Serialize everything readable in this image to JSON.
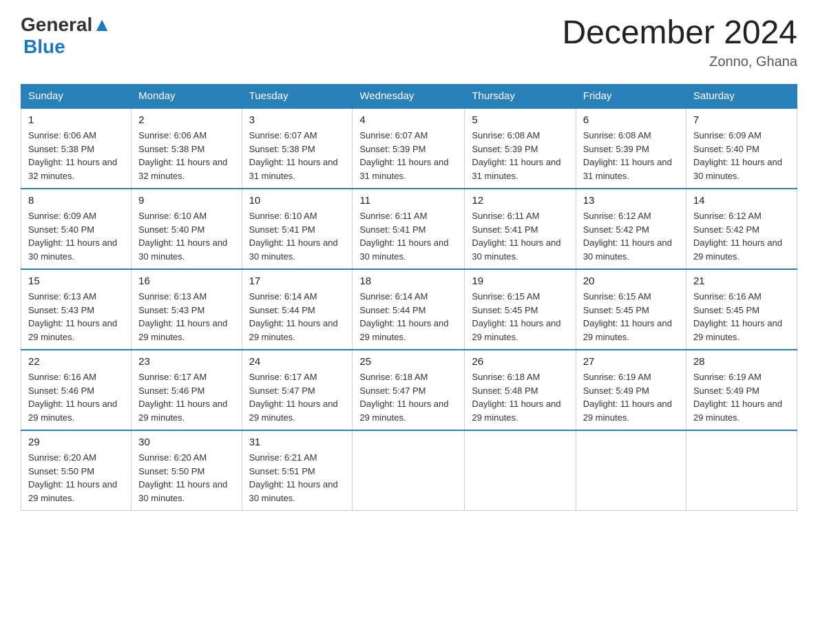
{
  "header": {
    "logo_general": "General",
    "logo_blue": "Blue",
    "month_year": "December 2024",
    "location": "Zonno, Ghana"
  },
  "days_of_week": [
    "Sunday",
    "Monday",
    "Tuesday",
    "Wednesday",
    "Thursday",
    "Friday",
    "Saturday"
  ],
  "weeks": [
    [
      {
        "day": "1",
        "sunrise": "6:06 AM",
        "sunset": "5:38 PM",
        "daylight": "11 hours and 32 minutes."
      },
      {
        "day": "2",
        "sunrise": "6:06 AM",
        "sunset": "5:38 PM",
        "daylight": "11 hours and 32 minutes."
      },
      {
        "day": "3",
        "sunrise": "6:07 AM",
        "sunset": "5:38 PM",
        "daylight": "11 hours and 31 minutes."
      },
      {
        "day": "4",
        "sunrise": "6:07 AM",
        "sunset": "5:39 PM",
        "daylight": "11 hours and 31 minutes."
      },
      {
        "day": "5",
        "sunrise": "6:08 AM",
        "sunset": "5:39 PM",
        "daylight": "11 hours and 31 minutes."
      },
      {
        "day": "6",
        "sunrise": "6:08 AM",
        "sunset": "5:39 PM",
        "daylight": "11 hours and 31 minutes."
      },
      {
        "day": "7",
        "sunrise": "6:09 AM",
        "sunset": "5:40 PM",
        "daylight": "11 hours and 30 minutes."
      }
    ],
    [
      {
        "day": "8",
        "sunrise": "6:09 AM",
        "sunset": "5:40 PM",
        "daylight": "11 hours and 30 minutes."
      },
      {
        "day": "9",
        "sunrise": "6:10 AM",
        "sunset": "5:40 PM",
        "daylight": "11 hours and 30 minutes."
      },
      {
        "day": "10",
        "sunrise": "6:10 AM",
        "sunset": "5:41 PM",
        "daylight": "11 hours and 30 minutes."
      },
      {
        "day": "11",
        "sunrise": "6:11 AM",
        "sunset": "5:41 PM",
        "daylight": "11 hours and 30 minutes."
      },
      {
        "day": "12",
        "sunrise": "6:11 AM",
        "sunset": "5:41 PM",
        "daylight": "11 hours and 30 minutes."
      },
      {
        "day": "13",
        "sunrise": "6:12 AM",
        "sunset": "5:42 PM",
        "daylight": "11 hours and 30 minutes."
      },
      {
        "day": "14",
        "sunrise": "6:12 AM",
        "sunset": "5:42 PM",
        "daylight": "11 hours and 29 minutes."
      }
    ],
    [
      {
        "day": "15",
        "sunrise": "6:13 AM",
        "sunset": "5:43 PM",
        "daylight": "11 hours and 29 minutes."
      },
      {
        "day": "16",
        "sunrise": "6:13 AM",
        "sunset": "5:43 PM",
        "daylight": "11 hours and 29 minutes."
      },
      {
        "day": "17",
        "sunrise": "6:14 AM",
        "sunset": "5:44 PM",
        "daylight": "11 hours and 29 minutes."
      },
      {
        "day": "18",
        "sunrise": "6:14 AM",
        "sunset": "5:44 PM",
        "daylight": "11 hours and 29 minutes."
      },
      {
        "day": "19",
        "sunrise": "6:15 AM",
        "sunset": "5:45 PM",
        "daylight": "11 hours and 29 minutes."
      },
      {
        "day": "20",
        "sunrise": "6:15 AM",
        "sunset": "5:45 PM",
        "daylight": "11 hours and 29 minutes."
      },
      {
        "day": "21",
        "sunrise": "6:16 AM",
        "sunset": "5:45 PM",
        "daylight": "11 hours and 29 minutes."
      }
    ],
    [
      {
        "day": "22",
        "sunrise": "6:16 AM",
        "sunset": "5:46 PM",
        "daylight": "11 hours and 29 minutes."
      },
      {
        "day": "23",
        "sunrise": "6:17 AM",
        "sunset": "5:46 PM",
        "daylight": "11 hours and 29 minutes."
      },
      {
        "day": "24",
        "sunrise": "6:17 AM",
        "sunset": "5:47 PM",
        "daylight": "11 hours and 29 minutes."
      },
      {
        "day": "25",
        "sunrise": "6:18 AM",
        "sunset": "5:47 PM",
        "daylight": "11 hours and 29 minutes."
      },
      {
        "day": "26",
        "sunrise": "6:18 AM",
        "sunset": "5:48 PM",
        "daylight": "11 hours and 29 minutes."
      },
      {
        "day": "27",
        "sunrise": "6:19 AM",
        "sunset": "5:49 PM",
        "daylight": "11 hours and 29 minutes."
      },
      {
        "day": "28",
        "sunrise": "6:19 AM",
        "sunset": "5:49 PM",
        "daylight": "11 hours and 29 minutes."
      }
    ],
    [
      {
        "day": "29",
        "sunrise": "6:20 AM",
        "sunset": "5:50 PM",
        "daylight": "11 hours and 29 minutes."
      },
      {
        "day": "30",
        "sunrise": "6:20 AM",
        "sunset": "5:50 PM",
        "daylight": "11 hours and 30 minutes."
      },
      {
        "day": "31",
        "sunrise": "6:21 AM",
        "sunset": "5:51 PM",
        "daylight": "11 hours and 30 minutes."
      },
      null,
      null,
      null,
      null
    ]
  ],
  "labels": {
    "sunrise": "Sunrise:",
    "sunset": "Sunset:",
    "daylight": "Daylight:"
  }
}
